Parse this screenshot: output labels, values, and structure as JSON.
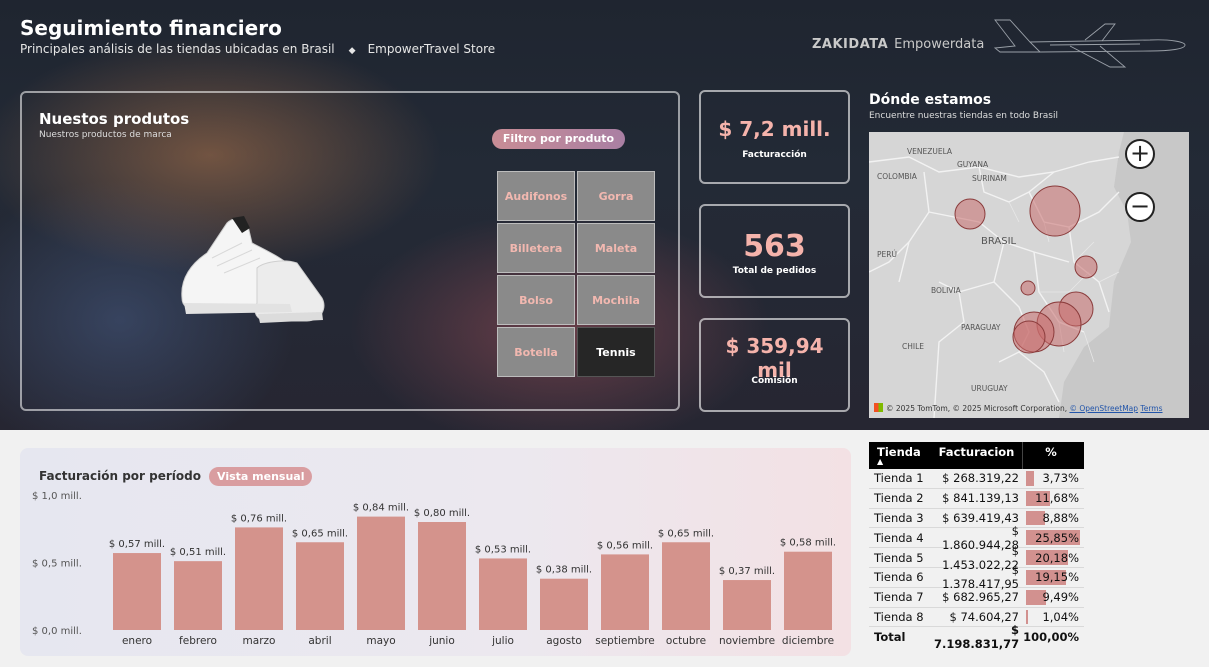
{
  "header": {
    "title": "Seguimiento financiero",
    "subtitle": "Principales análisis de las tiendas ubicadas en Brasil",
    "store": "EmpowerTravel Store",
    "brand_a": "ZAKIDATA",
    "brand_b": "Empowerdata"
  },
  "products": {
    "title": "Nuestos produtos",
    "subtitle": "Nuestros productos de marca",
    "filter_label": "Filtro por produto",
    "buttons": [
      "Audifonos",
      "Gorra",
      "Billetera",
      "Maleta",
      "Bolso",
      "Mochila",
      "Botella",
      "Tennis"
    ],
    "selected": "Tennis"
  },
  "kpis": {
    "facturacion_value": "$ 7,2 mill.",
    "facturacion_label": "Facturacción",
    "pedidos_value": "563",
    "pedidos_label": "Total de pedidos",
    "comision_value": "$ 359,94 mil",
    "comision_label": "Comisión"
  },
  "map": {
    "title": "Dónde estamos",
    "subtitle": "Encuentre nuestras tiendas en todo Brasil",
    "labels": [
      "VENEZUELA",
      "GUYANA",
      "SURINAM",
      "COLOMBIA",
      "BRASIL",
      "PERÚ",
      "BOLIVIA",
      "PARAGUAY",
      "CHILE",
      "URUGUAY"
    ],
    "attribution_prefix": "© 2025 TomTom, © 2025 Microsoft Corporation,",
    "attribution_osm": "© OpenStreetMap",
    "attribution_terms": "Terms"
  },
  "chart_panel": {
    "title": "Facturación por período",
    "toggle": "Vista mensual"
  },
  "chart_data": {
    "type": "bar",
    "categories": [
      "enero",
      "febrero",
      "marzo",
      "abril",
      "mayo",
      "junio",
      "julio",
      "agosto",
      "septiembre",
      "octubre",
      "noviembre",
      "diciembre"
    ],
    "values": [
      0.57,
      0.51,
      0.76,
      0.65,
      0.84,
      0.8,
      0.53,
      0.38,
      0.56,
      0.65,
      0.37,
      0.58
    ],
    "data_labels": [
      "$ 0,57 mill.",
      "$ 0,51 mill.",
      "$ 0,76 mill.",
      "$ 0,65 mill.",
      "$ 0,84 mill.",
      "$ 0,80 mill.",
      "$ 0,53 mill.",
      "$ 0,38 mill.",
      "$ 0,56 mill.",
      "$ 0,65 mill.",
      "$ 0,37 mill.",
      "$ 0,58 mill."
    ],
    "yticks": [
      0,
      0.5,
      1.0
    ],
    "ytick_labels": [
      "$ 0,0 mill.",
      "$ 0,5 mill.",
      "$ 1,0 mill."
    ],
    "ylim": [
      0,
      1.0
    ],
    "title": "Facturación por período",
    "xlabel": "",
    "ylabel": "",
    "bar_color": "#d4938c",
    "grid": false
  },
  "table": {
    "headers": [
      "Tienda",
      "Facturacion",
      "%"
    ],
    "rows": [
      {
        "tienda": "Tienda 1",
        "facturacion": "$ 268.319,22",
        "pct": "3,73%",
        "share": 3.73
      },
      {
        "tienda": "Tienda 2",
        "facturacion": "$ 841.139,13",
        "pct": "11,68%",
        "share": 11.68
      },
      {
        "tienda": "Tienda 3",
        "facturacion": "$ 639.419,43",
        "pct": "8,88%",
        "share": 8.88
      },
      {
        "tienda": "Tienda 4",
        "facturacion": "$ 1.860.944,28",
        "pct": "25,85%",
        "share": 25.85
      },
      {
        "tienda": "Tienda 5",
        "facturacion": "$ 1.453.022,22",
        "pct": "20,18%",
        "share": 20.18
      },
      {
        "tienda": "Tienda 6",
        "facturacion": "$ 1.378.417,95",
        "pct": "19,15%",
        "share": 19.15
      },
      {
        "tienda": "Tienda 7",
        "facturacion": "$ 682.965,27",
        "pct": "9,49%",
        "share": 9.49
      },
      {
        "tienda": "Tienda 8",
        "facturacion": "$ 74.604,27",
        "pct": "1,04%",
        "share": 1.04
      }
    ],
    "total_label": "Total",
    "total_facturacion": "$ 7.198.831,77",
    "total_pct": "100,00%"
  }
}
